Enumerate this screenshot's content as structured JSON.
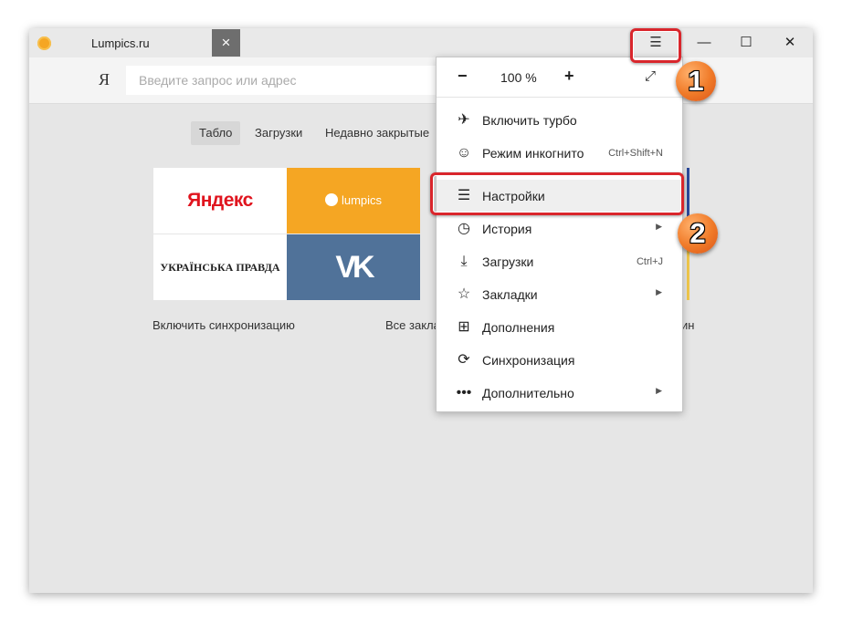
{
  "tab": {
    "title": "Lumpics.ru",
    "close_icon": "×"
  },
  "titlebar": {
    "menu_icon": "☰",
    "minimize_icon": "—",
    "maximize_icon": "☐",
    "close_icon": "✕"
  },
  "address": {
    "logo": "Я",
    "placeholder": "Введите запрос или адрес"
  },
  "board_tabs": [
    "Табло",
    "Загрузки",
    "Недавно закрытые"
  ],
  "tiles": {
    "yandex": "Яндекс",
    "lumpics": "lumpics",
    "up": "УКРАЇНСЬКА ПРАВДА",
    "vk": "VK"
  },
  "links": {
    "sync": "Включить синхронизацию",
    "all_bookmarks_partial": "Все закла",
    "right_partial": "ин"
  },
  "menu": {
    "zoom_minus": "−",
    "zoom_value": "100 %",
    "zoom_plus": "+",
    "fullscreen_icon": "⤢",
    "items": [
      {
        "icon": "✈",
        "label": "Включить турбо",
        "shortcut": "",
        "arrow": ""
      },
      {
        "icon": "☺",
        "label": "Режим инкогнито",
        "shortcut": "Ctrl+Shift+N",
        "arrow": ""
      },
      {
        "icon": "☰",
        "label": "Настройки",
        "shortcut": "",
        "arrow": ""
      },
      {
        "icon": "◷",
        "label": "История",
        "shortcut": "",
        "arrow": "▶"
      },
      {
        "icon": "⤓",
        "label": "Загрузки",
        "shortcut": "Ctrl+J",
        "arrow": ""
      },
      {
        "icon": "☆",
        "label": "Закладки",
        "shortcut": "",
        "arrow": "▶"
      },
      {
        "icon": "⊞",
        "label": "Дополнения",
        "shortcut": "",
        "arrow": ""
      },
      {
        "icon": "⟳",
        "label": "Синхронизация",
        "shortcut": "",
        "arrow": ""
      },
      {
        "icon": "•••",
        "label": "Дополнительно",
        "shortcut": "",
        "arrow": "▶"
      }
    ]
  },
  "badges": [
    "1",
    "2"
  ],
  "colors": {
    "highlight": "#d9262c",
    "badge": "#f07a28",
    "lumpics": "#f5a623",
    "vk": "#507299",
    "yandex": "#e0141e"
  }
}
